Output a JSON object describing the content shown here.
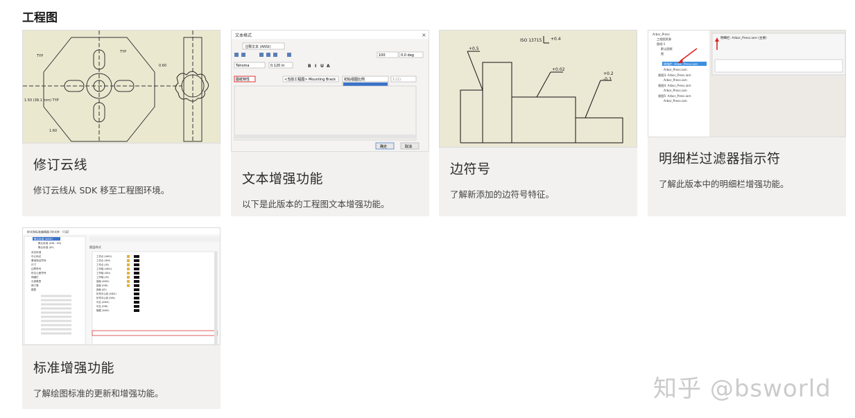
{
  "section": {
    "title": "工程图"
  },
  "cards": [
    {
      "title": "修订云线",
      "desc": "修订云线从 SDK 移至工程图环境。",
      "thumb_labels": [
        "TYP",
        "TYP",
        "1.50 (38.1 mm) TYP",
        "0.60",
        "1.60"
      ]
    },
    {
      "title": "文本增强功能",
      "desc": "以下是此版本的工程图文本增强功能。",
      "thumb_labels": {
        "window_title": "文本格式",
        "style": "注释文本 (ANSI)",
        "font": "Tahoma",
        "size": "0.120 in",
        "zoom": "100",
        "angle": "0.0 deg",
        "category": "图纸特性",
        "source": "<当前工程图> Mounting Brack",
        "property": "初始视图比例",
        "precision": "1:(1)",
        "ok": "确定",
        "cancel": "取消"
      }
    },
    {
      "title": "边符号",
      "desc": "了解新添加的边符号特征。",
      "thumb_labels": [
        "ISO 13715",
        "+0.4",
        "+0.5",
        "+0.02",
        "+0.2",
        "-0.3"
      ]
    },
    {
      "title": "明细栏过滤器指示符",
      "desc": "了解此版本中的明细栏增强功能。",
      "thumb_labels": {
        "tree_root": "Arbor_Press",
        "panel_title": "明细栏: Arbor_Press.iam (主要)",
        "tree_items": [
          "工程图资源",
          "图纸:1",
          "默认图框",
          "图",
          "明细栏: Arbor_Press.iam",
          "Arbor_Press.iam",
          "视图3: Arbor_Press.iam",
          "Arbor_Press.iam",
          "视图4: Arbor_Press.iam",
          "Arbor_Press.iam",
          "视图5: Arbor_Press.iam",
          "Arbor_Press.iam"
        ]
      }
    },
    {
      "title": "标准增强功能",
      "desc": "了解绘图标准的更新和增强功能。",
      "thumb_labels": {
        "window_title": "样式和标准编辑器 [样式库 - 只读]",
        "panel_title": "图层样式",
        "tree_items": [
          "默认标准 (ANSI)",
          "默认标准 (DIN - EN)",
          "默认标准 (JIS)",
          "对比标准",
          "中心标记",
          "基准特征符号",
          "尺寸",
          "边界符号",
          "形位公差符号",
          "明细栏",
          "孔参数表",
          "修订表",
          "图层"
        ],
        "layers": [
          "工作点 (ANSI)",
          "工作点 (DIN)",
          "工作点 (JIS)",
          "工作轴 (ANSI)",
          "工作轴 (DIN)",
          "工作轴 (JIS)",
          "剖面 (ANSI)",
          "剖面 (DIN)",
          "剖面 (JIS)",
          "折弯中心线 (ANSI)",
          "折弯中心线 (DIN)",
          "可见 (ANSI)",
          "可见 (DIN)",
          "隐藏 (ANSI)"
        ]
      }
    }
  ],
  "watermark": {
    "brand": "知乎",
    "handle": "@bsworld"
  }
}
